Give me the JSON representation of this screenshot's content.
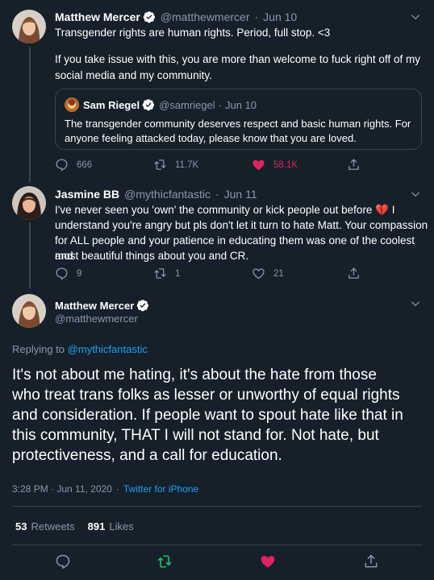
{
  "tweet1": {
    "name": "Matthew Mercer",
    "handle": "@matthewmercer",
    "dot": "·",
    "date": "Jun 10",
    "line1": "Transgender rights are human rights. Period, full stop. <3",
    "line2": "If you take issue with this, you are more than welcome to fuck right off of my",
    "line3": "social media and my community.",
    "quote": {
      "name": "Sam Riegel",
      "handle": "@samriegel",
      "dot": "·",
      "date": "Jun 10",
      "line1": "The transgender community deserves respect and basic human rights. For",
      "line2": "anyone feeling attacked today, please know that you are loved."
    },
    "replies": "666",
    "retweets": "11.7K",
    "likes": "58.1K"
  },
  "tweet2": {
    "name": "Jasmine BB",
    "handle": "@mythicfantastic",
    "dot": "·",
    "date": "Jun 11",
    "line1": "I've never seen you 'own' the community or kick people out before 💔 I",
    "line2": "understand you're angry but pls don't let it turn to hate Matt. Your compassion",
    "line3": "for ALL people and your patience in educating them was one of the coolest and",
    "line4": "most beautiful things about you and CR.",
    "replies": "9",
    "retweets": "1",
    "likes": "21"
  },
  "main": {
    "name": "Matthew Mercer",
    "handle": "@matthewmercer",
    "replying_prefix": "Replying to",
    "replying_to": "@mythicfantastic",
    "line1": "It's not about me hating, it's about the hate from those",
    "line2": "who treat trans folks as lesser or unworthy of equal rights",
    "line3": "and consideration. If people want to spout hate like that in",
    "line4": "this community, THAT I will not stand for. Not hate, but",
    "line5": "protectiveness, and a call for education.",
    "timestamp": "3:28 PM · Jun 11, 2020",
    "dot": "·",
    "source": "Twitter for iPhone",
    "retweet_count": "53",
    "retweet_label": "Retweets",
    "like_count": "891",
    "like_label": "Likes"
  },
  "colors": {
    "background": "#15202b",
    "accent": "#1da1f2",
    "like": "#e0245e",
    "retweet": "#17bf63",
    "muted": "#8899a6"
  }
}
